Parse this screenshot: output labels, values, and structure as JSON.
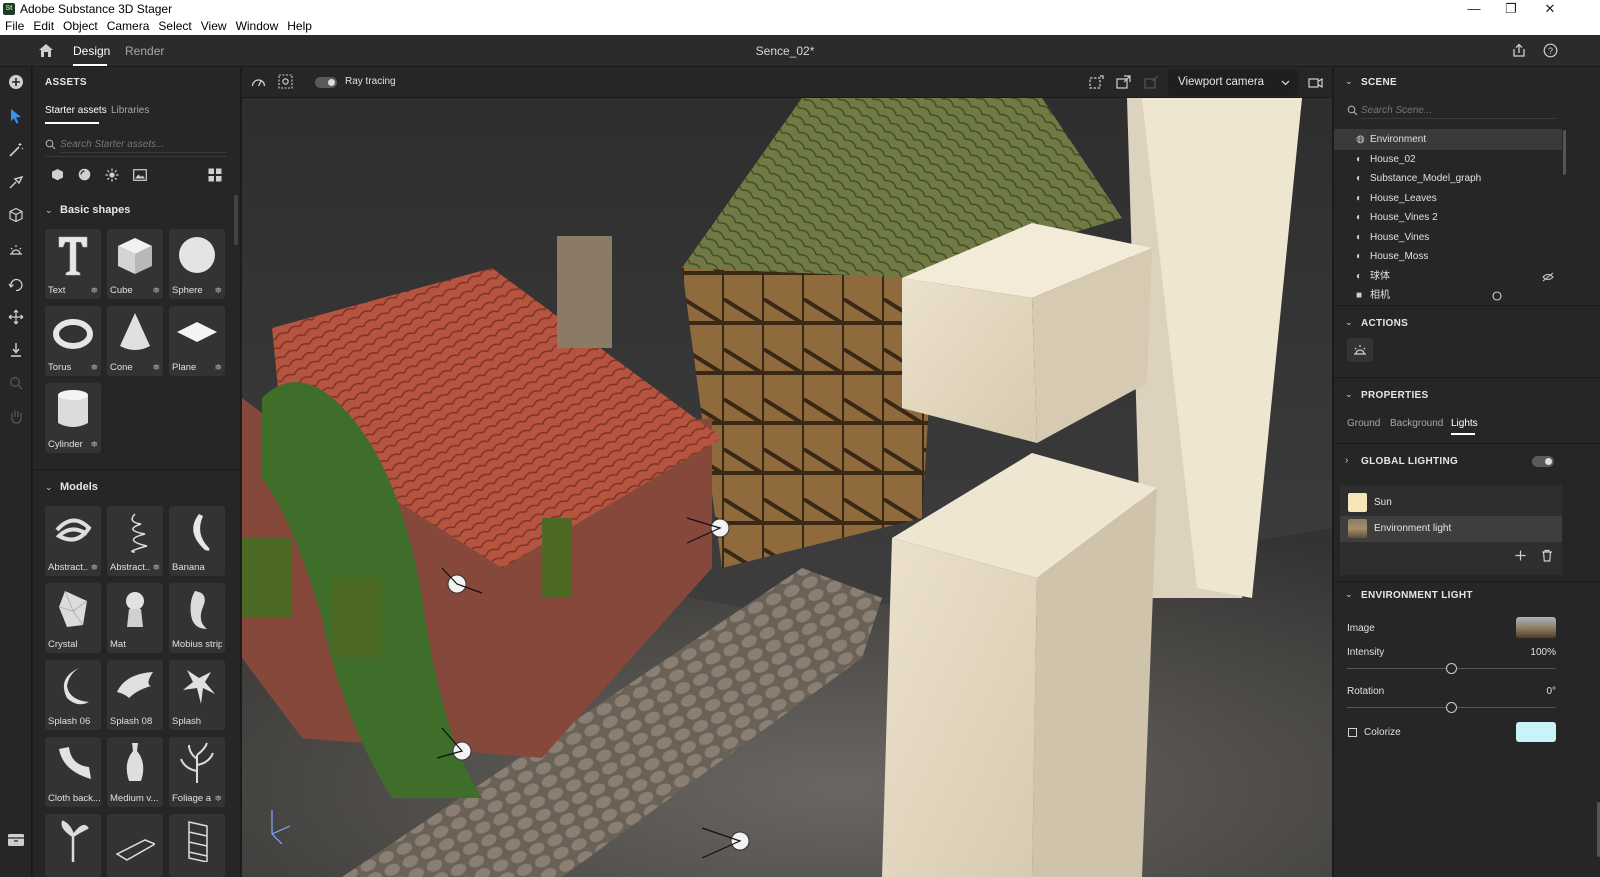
{
  "window": {
    "title": "Adobe Substance 3D Stager",
    "logo_text": "St",
    "minimize_icon": "—",
    "restore_icon": "❐",
    "close_icon": "✕"
  },
  "menu": [
    "File",
    "Edit",
    "Object",
    "Camera",
    "Select",
    "View",
    "Window",
    "Help"
  ],
  "appbar": {
    "tabs": [
      "Design",
      "Render"
    ],
    "active_tab": "Design",
    "document_title": "Sence_02*"
  },
  "assets": {
    "header": "ASSETS",
    "tabs": [
      "Starter assets",
      "Libraries"
    ],
    "search_placeholder": "Search Starter assets...",
    "basic_shapes_title": "Basic shapes",
    "basic_shapes": [
      "Text",
      "Cube",
      "Sphere",
      "Torus",
      "Cone",
      "Plane",
      "Cylinder"
    ],
    "models_title": "Models",
    "models": [
      "Abstract...",
      "Abstract...",
      "Banana",
      "Crystal",
      "Mat",
      "Mobius strip",
      "Splash 06",
      "Splash 08",
      "Splash",
      "Cloth back...",
      "Medium v...",
      "Foliage a"
    ]
  },
  "viewport": {
    "ray_tracing_label": "Ray tracing",
    "camera_select": "Viewport camera"
  },
  "scene": {
    "header": "SCENE",
    "search_placeholder": "Search Scene...",
    "items": [
      "Environment",
      "House_02",
      "Substance_Model_graph",
      "House_Leaves",
      "House_Vines 2",
      "House_Vines",
      "House_Moss",
      "球体",
      "相机"
    ],
    "selected": "Environment"
  },
  "actions": {
    "header": "ACTIONS"
  },
  "properties": {
    "header": "PROPERTIES",
    "tabs": [
      "Ground",
      "Background",
      "Lights"
    ],
    "active_tab": "Lights",
    "global_lighting": "GLOBAL LIGHTING",
    "lights": [
      "Sun",
      "Environment light"
    ],
    "selected_light": "Environment light",
    "env_header": "ENVIRONMENT LIGHT",
    "image_label": "Image",
    "intensity_label": "Intensity",
    "intensity_value": "100%",
    "intensity_level": 0.5,
    "rotation_label": "Rotation",
    "rotation_value": "0°",
    "rotation_level": 0.5,
    "colorize_label": "Colorize",
    "colorize_color": "#c8f4f8",
    "sun_color": "#f5e6b8"
  }
}
